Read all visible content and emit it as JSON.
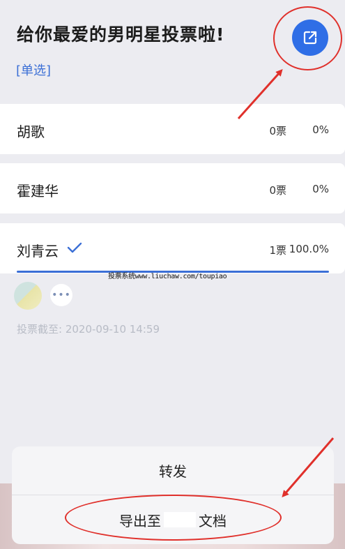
{
  "poll": {
    "title": "给你最爱的男明星投票啦!",
    "mode_tag": "[单选]",
    "options": [
      {
        "label": "胡歌",
        "votes": "0票",
        "percent": "0%",
        "progress": 0,
        "selected": false
      },
      {
        "label": "霍建华",
        "votes": "0票",
        "percent": "0%",
        "progress": 0,
        "selected": false
      },
      {
        "label": "刘青云",
        "votes": "1票",
        "percent": "100.0%",
        "progress": 1.0,
        "selected": true
      }
    ],
    "deadline": "投票截至: 2020-09-10 14:59",
    "more_label": "•••"
  },
  "watermark": "投票系统www.liuchaw.com/toupiao",
  "share_sheet": {
    "items": [
      {
        "label": "转发"
      },
      {
        "label_prefix": "导出至",
        "label_suffix": "文档"
      }
    ]
  },
  "colors": {
    "accent": "#2f6ee6",
    "annotation": "#e0302b",
    "progress": "#3b6fd6"
  }
}
